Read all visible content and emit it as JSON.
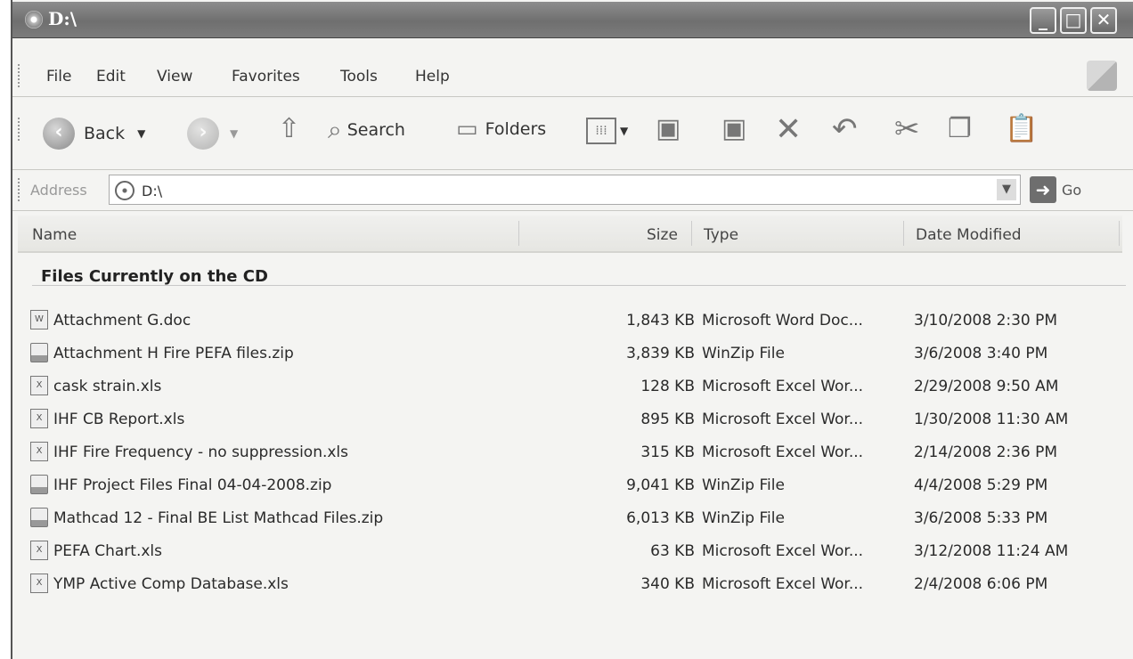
{
  "window": {
    "title": "D:\\"
  },
  "title_buttons": {
    "minimize": "_",
    "maximize": "□",
    "close": "✕"
  },
  "menu": [
    "File",
    "Edit",
    "View",
    "Favorites",
    "Tools",
    "Help"
  ],
  "toolbar": {
    "back_label": "Back",
    "search_label": "Search",
    "folders_label": "Folders"
  },
  "address": {
    "label": "Address",
    "value": "D:\\",
    "go_label": "Go"
  },
  "columns": {
    "name": "Name",
    "size": "Size",
    "type": "Type",
    "date": "Date Modified"
  },
  "group": {
    "title": "Files Currently on the CD"
  },
  "files": [
    {
      "name": "Attachment G.doc",
      "size": "1,843 KB",
      "type": "Microsoft Word Doc...",
      "date": "3/10/2008 2:30 PM",
      "icon": "word-doc-icon"
    },
    {
      "name": "Attachment H Fire PEFA files.zip",
      "size": "3,839 KB",
      "type": "WinZip File",
      "date": "3/6/2008 3:40 PM",
      "icon": "zip-file-icon"
    },
    {
      "name": "cask strain.xls",
      "size": "128 KB",
      "type": "Microsoft Excel Wor...",
      "date": "2/29/2008 9:50 AM",
      "icon": "excel-file-icon"
    },
    {
      "name": "IHF CB Report.xls",
      "size": "895 KB",
      "type": "Microsoft Excel Wor...",
      "date": "1/30/2008 11:30 AM",
      "icon": "excel-file-icon"
    },
    {
      "name": "IHF Fire Frequency - no suppression.xls",
      "size": "315 KB",
      "type": "Microsoft Excel Wor...",
      "date": "2/14/2008 2:36 PM",
      "icon": "excel-file-icon"
    },
    {
      "name": "IHF Project Files Final 04-04-2008.zip",
      "size": "9,041 KB",
      "type": "WinZip File",
      "date": "4/4/2008 5:29 PM",
      "icon": "zip-file-icon"
    },
    {
      "name": "Mathcad 12 -  Final BE List Mathcad Files.zip",
      "size": "6,013 KB",
      "type": "WinZip File",
      "date": "3/6/2008 5:33 PM",
      "icon": "zip-file-icon"
    },
    {
      "name": "PEFA Chart.xls",
      "size": "63 KB",
      "type": "Microsoft Excel Wor...",
      "date": "3/12/2008 11:24 AM",
      "icon": "excel-file-icon"
    },
    {
      "name": "YMP Active Comp Database.xls",
      "size": "340 KB",
      "type": "Microsoft Excel Wor...",
      "date": "2/4/2008 6:06 PM",
      "icon": "excel-file-icon"
    }
  ]
}
